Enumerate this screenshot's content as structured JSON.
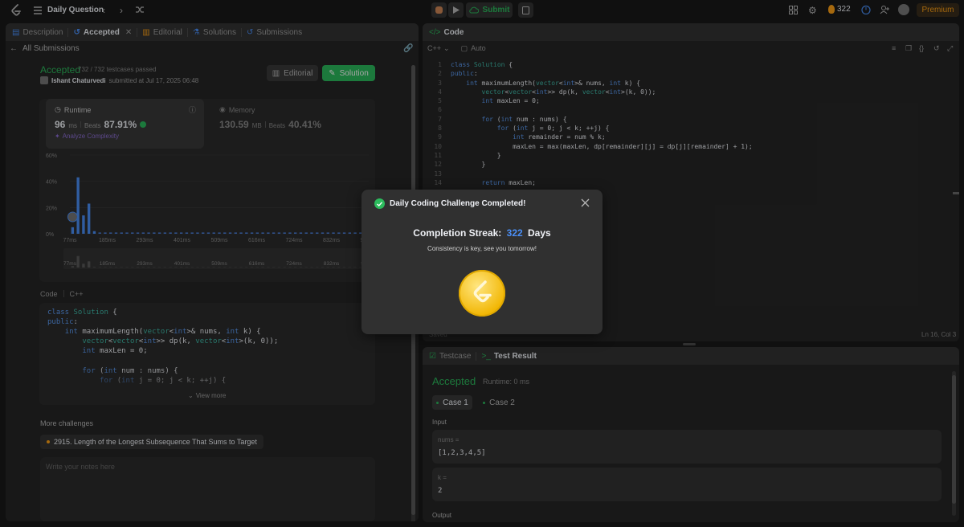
{
  "topbar": {
    "title": "Daily Question",
    "submit_label": "Submit",
    "streak_count": "322",
    "premium_label": "Premium"
  },
  "left": {
    "tabs": [
      {
        "label": "Description"
      },
      {
        "label": "Accepted"
      },
      {
        "label": "Editorial"
      },
      {
        "label": "Solutions"
      },
      {
        "label": "Submissions"
      }
    ],
    "back_label": "All Submissions",
    "status": "Accepted",
    "testcases": "732 / 732 testcases passed",
    "user_name": "Ishant Chaturvedi",
    "submitted_text": "submitted at Jul 17, 2025 06:48",
    "editorial_btn": "Editorial",
    "solution_btn": "Solution",
    "runtime": {
      "title": "Runtime",
      "value": "96",
      "unit": "ms",
      "beats_label": "Beats",
      "beats": "87.91%",
      "analyze": "Analyze Complexity"
    },
    "memory": {
      "title": "Memory",
      "value": "130.59",
      "unit": "MB",
      "beats_label": "Beats",
      "beats": "40.41%"
    },
    "code_label": "Code",
    "lang_label": "C++",
    "code_lines": [
      "class Solution {",
      "public:",
      "    int maximumLength(vector<int>& nums, int k) {",
      "        vector<vector<int>> dp(k, vector<int>(k, 0));",
      "        int maxLen = 0;",
      "",
      "        for (int num : nums) {",
      "            for (int j = 0; j < k; ++j) {"
    ],
    "view_more": "View more",
    "more_challenges": "More challenges",
    "challenge_item": "2915. Length of the Longest Subsequence That Sums to Target",
    "notes_placeholder": "Write your notes here"
  },
  "chart_data": {
    "type": "bar",
    "y_ticks": [
      "60%",
      "40%",
      "20%",
      "0%"
    ],
    "x_ticks": [
      "77ms",
      "185ms",
      "293ms",
      "401ms",
      "509ms",
      "616ms",
      "724ms",
      "832ms",
      "939ms"
    ],
    "ylim": [
      0,
      60
    ],
    "values": [
      5,
      43,
      14,
      23,
      2,
      1,
      1,
      1,
      1,
      1,
      1,
      1,
      1,
      1,
      1,
      1,
      1,
      1,
      1,
      1,
      1,
      1,
      1,
      1,
      1,
      1,
      1,
      1,
      1,
      1,
      1,
      1,
      1,
      1,
      1,
      1,
      1,
      1,
      1,
      1,
      1,
      1,
      1,
      1,
      1,
      1,
      1,
      1,
      1,
      1,
      1,
      1,
      1,
      1,
      1
    ],
    "highlight_index": 0
  },
  "editor": {
    "title": "Code",
    "lang": "C++",
    "mode": "Auto",
    "line_numbers": [
      "1",
      "2",
      "3",
      "4",
      "5",
      "6",
      "7",
      "8",
      "9",
      "10",
      "11",
      "12",
      "13",
      "14"
    ],
    "lines": [
      "class Solution {",
      "public:",
      "    int maximumLength(vector<int>& nums, int k) {",
      "        vector<vector<int>> dp(k, vector<int>(k, 0));",
      "        int maxLen = 0;",
      "",
      "        for (int num : nums) {",
      "            for (int j = 0; j < k; ++j) {",
      "                int remainder = num % k;",
      "                maxLen = max(maxLen, dp[remainder][j] = dp[j][remainder] + 1);",
      "            }",
      "        }",
      "",
      "        return maxLen;"
    ],
    "saved_label": "Saved",
    "cursor_pos": "Ln 16, Col 3"
  },
  "result": {
    "tab_testcase": "Testcase",
    "tab_result": "Test Result",
    "status": "Accepted",
    "runtime": "Runtime: 0 ms",
    "case1": "Case 1",
    "case2": "Case 2",
    "input_label": "Input",
    "var1_name": "nums =",
    "var1_value": "[1,2,3,4,5]",
    "var2_name": "k =",
    "var2_value": "2",
    "output_label": "Output"
  },
  "modal": {
    "title": "Daily Coding Challenge Completed!",
    "streak_label": "Completion Streak:",
    "streak_value": "322",
    "streak_unit": "Days",
    "message": "Consistency is key, see you tomorrow!"
  },
  "colors": {
    "accent_green": "#2cbb5d",
    "accent_blue": "#4a8ff7",
    "badge_gold": "#ffcc33",
    "streak_orange": "#ffa116"
  }
}
